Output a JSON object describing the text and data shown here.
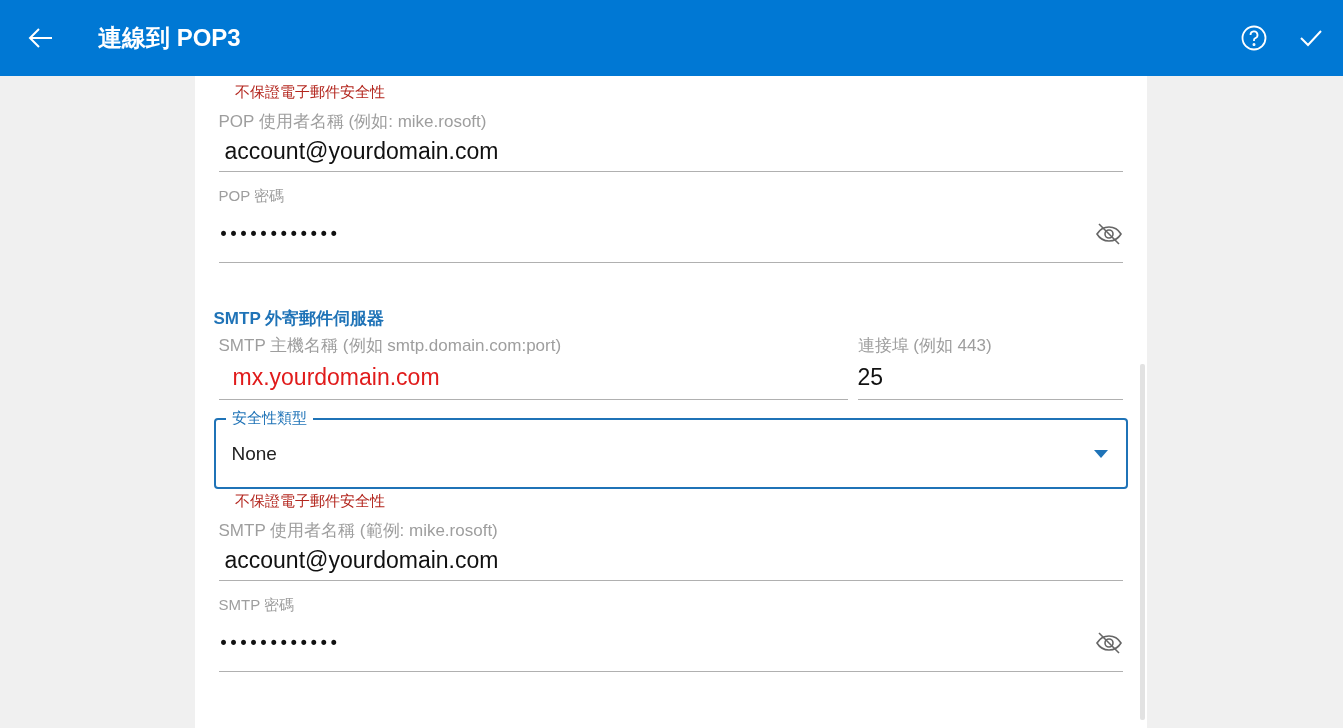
{
  "header": {
    "title": "連線到 POP3"
  },
  "items": [
    {
      "kind": "warning",
      "text": "不保證電子郵件安全性"
    },
    {
      "kind": "text",
      "label": "POP 使用者名稱 (例如: mike.rosoft)",
      "value": "account@yourdomain.com",
      "highlighted": false
    },
    {
      "kind": "password",
      "label": "POP 密碼",
      "value": "••••••••••••"
    },
    {
      "kind": "heading",
      "text": "SMTP 外寄郵件伺服器"
    },
    {
      "kind": "pair",
      "fields": [
        {
          "label": "SMTP 主機名稱 (例如 smtp.domain.com:port)",
          "value": "mx.yourdomain.com",
          "highlighted": true
        },
        {
          "label": "連接埠 (例如 443)",
          "value": "25",
          "highlighted": false
        }
      ]
    },
    {
      "kind": "select",
      "label": "安全性類型",
      "value": "None"
    },
    {
      "kind": "warning",
      "text": "不保證電子郵件安全性"
    },
    {
      "kind": "text",
      "label": "SMTP 使用者名稱 (範例: mike.rosoft)",
      "value": "account@yourdomain.com",
      "highlighted": false
    },
    {
      "kind": "password",
      "label": "SMTP 密碼",
      "value": "••••••••••••"
    }
  ]
}
